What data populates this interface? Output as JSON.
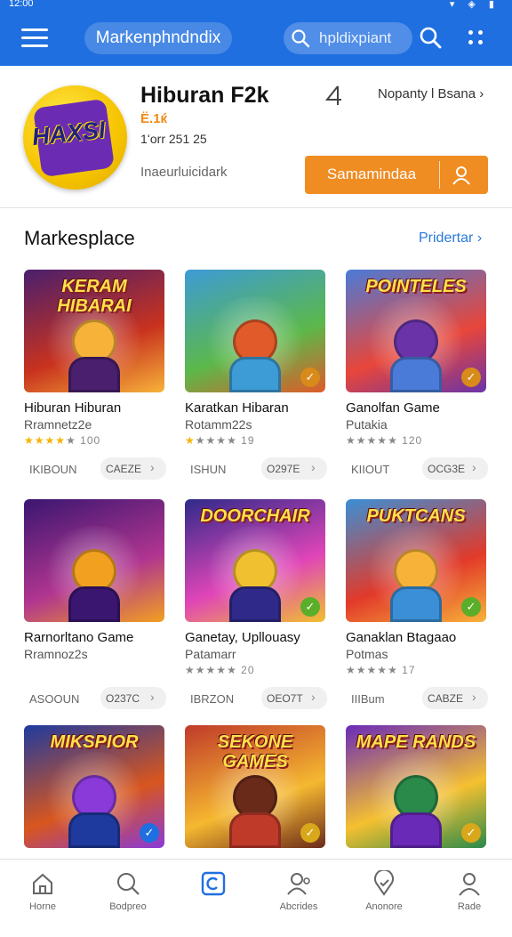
{
  "status_bar": {
    "time": "12:00"
  },
  "top_bar": {
    "title": "Markenphndndix",
    "search_placeholder": "hpldixpiant"
  },
  "app": {
    "name": "Hiburan  F2k",
    "rating": "Ё.1ќ",
    "downloads": "1ʻorr 251 25",
    "developer": "Inaeurluicidark",
    "developer_link": "Nopanty l Bsana",
    "install_label": "Samamindaa",
    "icon_text": "HAXSI"
  },
  "section": {
    "title": "Markesplace",
    "link": "Pridertar"
  },
  "cards": [
    {
      "banner": "KERAM HIBARAI",
      "title": "Hiburan Hiburan",
      "sub": "Rramnetz2e",
      "stars": 4,
      "count": "100",
      "foot_left": "IKIBOUN",
      "foot_right": "CAEZE",
      "colors": [
        "#4a1f6e",
        "#c8321e",
        "#f7b23a"
      ],
      "corner": ""
    },
    {
      "banner": "",
      "title": "Karatkan Hibaran",
      "sub": "Rotamm22s",
      "stars": 1,
      "count": "19",
      "foot_left": "ISHUN",
      "foot_right": "O297E",
      "colors": [
        "#3d9bd6",
        "#5cb84a",
        "#e05a2a"
      ],
      "corner": "#d88a1a"
    },
    {
      "banner": "POINTELES",
      "title": "Ganolfan Game",
      "sub": "Putakia",
      "stars": 0,
      "count": "120",
      "foot_left": "KIIOUT",
      "foot_right": "OCG3E",
      "colors": [
        "#4a7bd8",
        "#e8463a",
        "#6a34a8"
      ],
      "corner": "#d88a1a"
    },
    {
      "banner": "",
      "title": "Rarnorltano Game",
      "sub": "Rramnoz2s",
      "stars": 0,
      "count": "",
      "foot_left": "ASOOUN",
      "foot_right": "O237C",
      "colors": [
        "#3a1670",
        "#b03590",
        "#f1a020"
      ],
      "corner": ""
    },
    {
      "banner": "DOORCHAIR",
      "title": "Ganetay, Upllouasy",
      "sub": "Patamarr",
      "stars": 0,
      "count": "20",
      "foot_left": "IBRZON",
      "foot_right": "OEO7T",
      "colors": [
        "#2f2a8a",
        "#e045b8",
        "#f0c030"
      ],
      "corner": "#5aae2a"
    },
    {
      "banner": "PUKTCANS",
      "title": "Ganaklan Btagaao",
      "sub": "Potmas",
      "stars": 0,
      "count": "17",
      "foot_left": "IIIBum",
      "foot_right": "CABZE",
      "colors": [
        "#3a8fd6",
        "#e23a2a",
        "#f7b23a"
      ],
      "corner": "#5aae2a"
    },
    {
      "banner": "MIKSPIOR",
      "title": "",
      "sub": "",
      "stars": 0,
      "count": "",
      "foot_left": "",
      "foot_right": "",
      "colors": [
        "#1f3a9e",
        "#d8561e",
        "#8a3ad8"
      ],
      "corner": "#1f6fe0"
    },
    {
      "banner": "SEKONE GAMES",
      "title": "",
      "sub": "",
      "stars": 0,
      "count": "",
      "foot_left": "",
      "foot_right": "",
      "colors": [
        "#c03a2a",
        "#f5b830",
        "#6a2a1a"
      ],
      "corner": "#d8a81a"
    },
    {
      "banner": "MAPE RANDS",
      "title": "",
      "sub": "",
      "stars": 0,
      "count": "",
      "foot_left": "",
      "foot_right": "",
      "colors": [
        "#6a2ab8",
        "#f5c030",
        "#2a8a4a"
      ],
      "corner": "#d8a81a"
    }
  ],
  "bottom_nav": [
    {
      "label": "Horne",
      "icon": "home-icon"
    },
    {
      "label": "Bodpreo",
      "icon": "search-icon"
    },
    {
      "label": "",
      "icon": "apps-icon",
      "active": true
    },
    {
      "label": "Abcrides",
      "icon": "profile-group-icon"
    },
    {
      "label": "Anonore",
      "icon": "location-icon"
    },
    {
      "label": "Rade",
      "icon": "user-icon"
    }
  ],
  "colors": {
    "primary": "#1f6fe0",
    "accent": "#ef8c22",
    "link": "#2a7ad8"
  }
}
